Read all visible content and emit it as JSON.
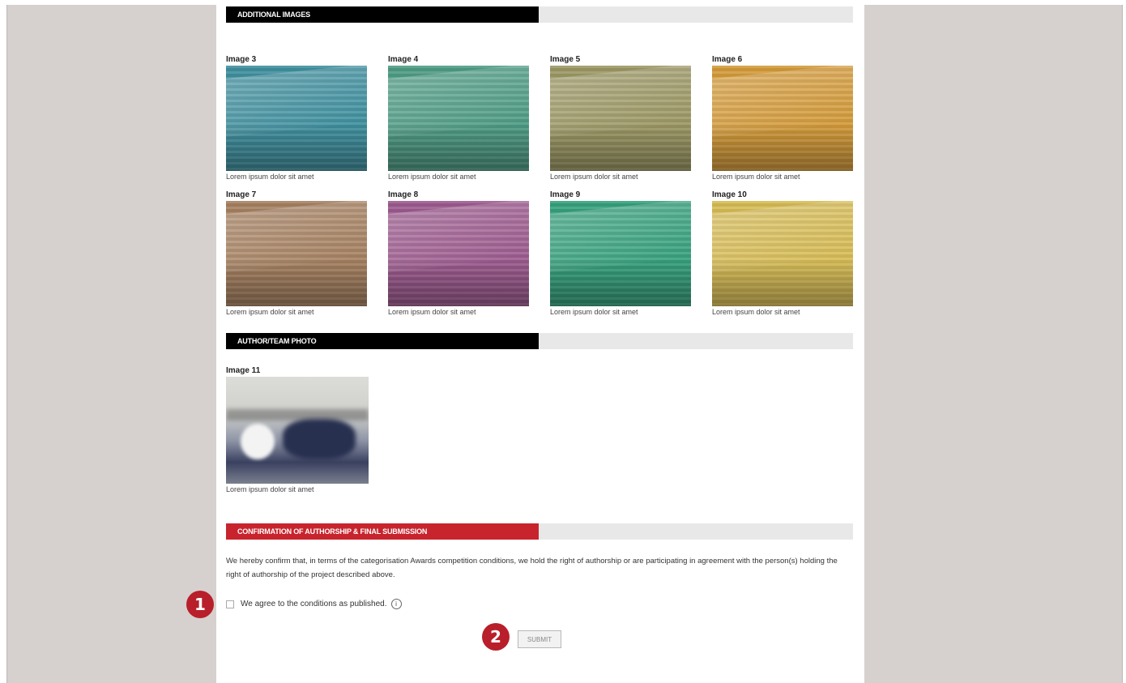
{
  "sections": {
    "additional_images": "ADDITIONAL IMAGES",
    "author_photo": "AUTHOR/TEAM PHOTO",
    "confirmation": "CONFIRMATION OF AUTHORSHIP & FINAL SUBMISSION"
  },
  "images": [
    {
      "label": "Image 3",
      "caption": "Lorem ipsum dolor sit amet",
      "color": "#3f8f9e"
    },
    {
      "label": "Image 4",
      "caption": "Lorem ipsum dolor sit amet",
      "color": "#4e9b84"
    },
    {
      "label": "Image 5",
      "caption": "Lorem ipsum dolor sit amet",
      "color": "#9b9764"
    },
    {
      "label": "Image 6",
      "caption": "Lorem ipsum dolor sit amet",
      "color": "#d39a3a"
    },
    {
      "label": "Image 7",
      "caption": "Lorem ipsum dolor sit amet",
      "color": "#a58060"
    },
    {
      "label": "Image 8",
      "caption": "Lorem ipsum dolor sit amet",
      "color": "#9c5a8e"
    },
    {
      "label": "Image 9",
      "caption": "Lorem ipsum dolor sit amet",
      "color": "#36a07c"
    },
    {
      "label": "Image 10",
      "caption": "Lorem ipsum dolor sit amet",
      "color": "#d6bb55"
    }
  ],
  "author_image": {
    "label": "Image 11",
    "caption": "Lorem ipsum dolor sit amet"
  },
  "confirmation": {
    "text": "We hereby confirm that, in terms of the categorisation Awards competition conditions, we hold the right of authorship or are participating in agreement with the person(s) holding the right of authorship of the project described above.",
    "agree_label": "We agree to the conditions as published.",
    "agree_checked": false,
    "submit_label": "SUBMIT"
  },
  "markers": [
    "1",
    "2"
  ],
  "colors": {
    "background": "#d6d1ce",
    "accent_red": "#c8242d",
    "marker": "#b81f2a"
  }
}
